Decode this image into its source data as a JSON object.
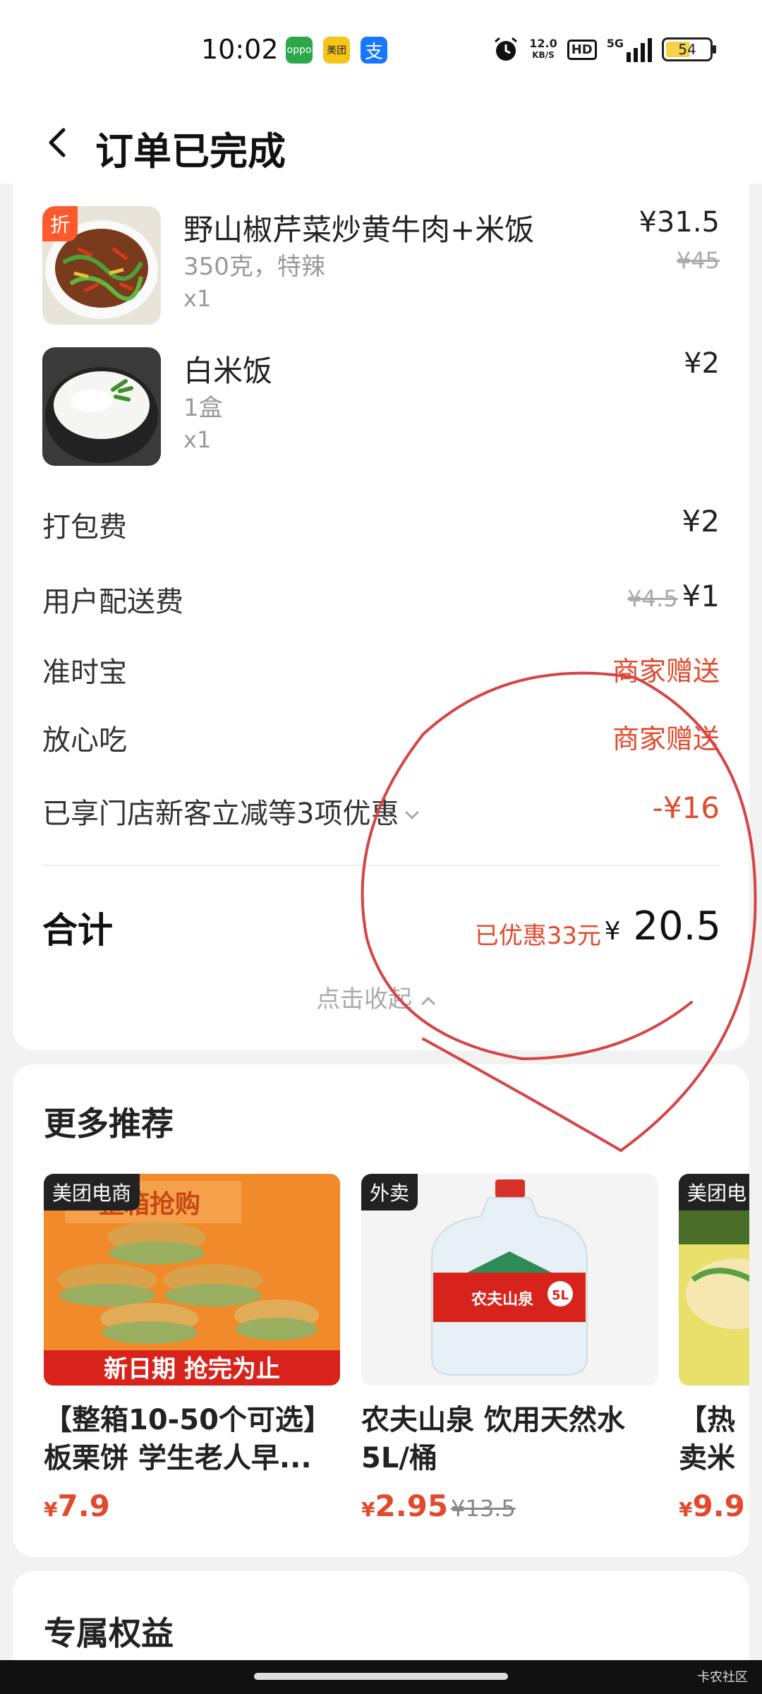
{
  "status_bar": {
    "time": "10:02",
    "apps": [
      {
        "label": "oppo",
        "color": "#2aa84a"
      },
      {
        "label": "美团",
        "color": "#f5c518"
      },
      {
        "label": "支",
        "color": "#1677ff"
      }
    ],
    "net_speed": "12.0",
    "net_unit": "KB/S",
    "hd": "HD",
    "signal": "5G",
    "battery": "54"
  },
  "header": {
    "title": "订单已完成"
  },
  "items": [
    {
      "name": "野山椒芹菜炒黄牛肉+米饭",
      "spec": "350克，特辣",
      "qty": "x1",
      "price": "¥31.5",
      "orig": "¥45",
      "badge": "折"
    },
    {
      "name": "白米饭",
      "spec": "1盒",
      "qty": "x1",
      "price": "¥2"
    }
  ],
  "fees": {
    "packing_label": "打包费",
    "packing_value": "¥2",
    "delivery_label": "用户配送费",
    "delivery_orig": "¥4.5",
    "delivery_value": "¥1",
    "ontime_label": "准时宝",
    "ontime_value": "商家赠送",
    "safe_label": "放心吃",
    "safe_value": "商家赠送",
    "discount_label": "已享门店新客立减等3项优惠",
    "discount_value": "-¥16"
  },
  "summary": {
    "total_label": "合计",
    "saved": "已优惠33元",
    "currency": "¥",
    "total": "20.5",
    "collapse": "点击收起"
  },
  "recommend": {
    "title": "更多推荐",
    "products": [
      {
        "tag": "美团电商",
        "name": "【整箱10-50个可选】板栗饼 学生老人早...",
        "currency": "¥",
        "price": "7.9",
        "orig": "",
        "banner_top": "整箱抢购",
        "banner_bottom": "新日期 抢完为止"
      },
      {
        "tag": "外卖",
        "name": "农夫山泉 饮用天然水5L/桶",
        "currency": "¥",
        "price": "2.95",
        "orig": "¥13.5",
        "bottle_label": "农夫山泉",
        "bottle_size": "5L"
      },
      {
        "tag": "美团电",
        "name": "【热卖米线吖",
        "currency": "¥",
        "price": "9.9",
        "orig": ""
      }
    ]
  },
  "rights": {
    "title": "专属权益"
  },
  "watermark": "卡农社区",
  "colors": {
    "accent_red": "#e24a2c",
    "background": "#f2f2f2"
  }
}
